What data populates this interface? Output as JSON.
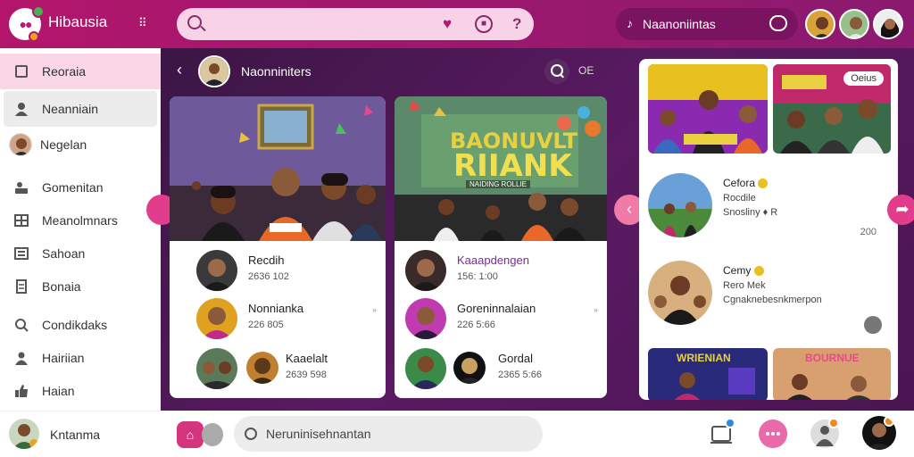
{
  "app": {
    "title": "Hibausia",
    "collapse_glyph": "⠿"
  },
  "search": {
    "placeholder": ""
  },
  "user_pill": {
    "name": "Naanoniintas"
  },
  "sidebar": {
    "items": [
      {
        "label": "Reoraia",
        "icon": "calendar-icon",
        "active": true
      },
      {
        "label": "Neanniain",
        "icon": "user-icon",
        "hover": true
      },
      {
        "label": "Negelan",
        "icon": "avatar"
      },
      {
        "label": "Gomenitan",
        "icon": "user-card-icon"
      },
      {
        "label": "Meanolmnars",
        "icon": "grid-icon"
      },
      {
        "label": "Sahoan",
        "icon": "list-icon"
      },
      {
        "label": "Bonaia",
        "icon": "document-icon"
      },
      {
        "label": "Condikdaks",
        "icon": "search-user-icon"
      },
      {
        "label": "Hairiian",
        "icon": "group-icon"
      },
      {
        "label": "Haian",
        "icon": "thumbs-up-icon"
      }
    ],
    "footer": {
      "label": "Kntanma"
    }
  },
  "chat": {
    "title": "Naonniniters",
    "more_label": "OE"
  },
  "cards": [
    {
      "rows": [
        {
          "name": "Recdih",
          "meta": "2636  102"
        },
        {
          "name": "Nonnianka",
          "meta": "226  805"
        },
        {
          "name": "Kaaelalt",
          "meta": "2639  598"
        }
      ]
    },
    {
      "banner_text": "BAONUVLT",
      "banner_text2": "RIIANK",
      "banner_sub": "NAIDING ROLLIE",
      "rows": [
        {
          "name": "Kaaapdengen",
          "meta": "156: 1:00"
        },
        {
          "name": "Goreninnalaian",
          "meta": "226  5:66"
        },
        {
          "name": "Gordal",
          "meta": "2365  5:66"
        }
      ]
    }
  ],
  "panel": {
    "thumb_tag": "Oeius",
    "rows": [
      {
        "name": "Cefora",
        "line2": "Rocdile",
        "line3": "Snosliny  ♦ R",
        "num": "200"
      },
      {
        "name": "Cemy",
        "line2": "Rero Mek",
        "line3": "Cgnaknebesnkmerpon",
        "num": ""
      }
    ],
    "bottom_thumb1": "WRIENIAN",
    "bottom_thumb2": "BOURNUE"
  },
  "composer": {
    "placeholder": "Neruninisehnantan"
  },
  "colors": {
    "brand": "#b3166b",
    "accent": "#e23c8c",
    "bg": "#5a1a5e"
  }
}
